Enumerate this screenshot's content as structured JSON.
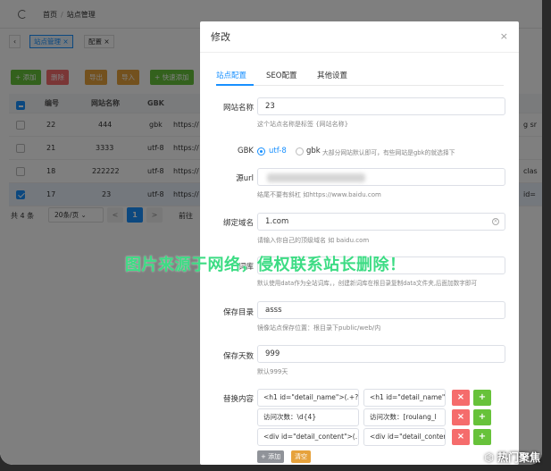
{
  "background": {
    "breadcrumb": [
      "首页",
      "站点管理"
    ],
    "tags": [
      {
        "label": "站点管理",
        "active": true
      },
      {
        "label": "配置",
        "active": false
      }
    ],
    "toolbar": [
      {
        "label": "+ 添加",
        "color": "#67c23a"
      },
      {
        "label": "删除",
        "color": "#f56c6c"
      },
      {
        "label": "导出",
        "color": "#e6a23c"
      },
      {
        "label": "导入",
        "color": "#e6a23c"
      },
      {
        "label": "+ 快速添加",
        "color": "#67c23a"
      }
    ],
    "table": {
      "headers": [
        "编号",
        "网站名称",
        "GBK",
        ""
      ],
      "rows": [
        {
          "id": "22",
          "name": "444",
          "gbk": "gbk",
          "url": "https://",
          "tail": "g sr",
          "checked": false
        },
        {
          "id": "21",
          "name": "3333",
          "gbk": "utf-8",
          "url": "https://",
          "tail": "",
          "checked": false
        },
        {
          "id": "18",
          "name": "222222",
          "gbk": "utf-8",
          "url": "https://",
          "tail": "clas",
          "checked": false
        },
        {
          "id": "17",
          "name": "23",
          "gbk": "utf-8",
          "url": "https://",
          "tail": "id=",
          "checked": true
        }
      ]
    },
    "pager": {
      "total": "共 4 条",
      "page_size": "20条/页",
      "prev": "<",
      "current": "1",
      "next": ">",
      "goto": "前往"
    }
  },
  "modal": {
    "title": "修改",
    "close": "×",
    "tabs": [
      {
        "label": "站点配置",
        "active": true
      },
      {
        "label": "SEO配置",
        "active": false
      },
      {
        "label": "其他设置",
        "active": false
      }
    ],
    "site_name": {
      "label": "网站名称",
      "value": "23",
      "hint": "这个站点名称是标签 {网站名称}"
    },
    "gbk": {
      "label": "GBK",
      "options": [
        "utf-8",
        "gbk"
      ],
      "selected": "utf-8",
      "hint": "大部分网站默认即可，有些网站是gbk的就选择下"
    },
    "source_url": {
      "label": "源url",
      "hint": "结尾不要有斜杠 如https://www.baidu.com"
    },
    "domain": {
      "label": "绑定域名",
      "value": "1.com",
      "hint": "请输入你自己的顶级域名 如 baidu.com"
    },
    "keywords": {
      "label": "词库",
      "hint": "默认使用data作为全站词库，，创建新词库在根目录复制data文件夹,后面加数字即可"
    },
    "save_dir": {
      "label": "保存目录",
      "value": "asss",
      "hint": "镜像站点保存位置：根目录下public/web/内"
    },
    "save_days": {
      "label": "保存天数",
      "value": "999",
      "hint": "默认999天"
    },
    "replace": {
      "label": "替换内容",
      "rows": [
        {
          "from": "<h1 id=\"detail_name\">(.+?)<",
          "to": "<h1 id=\"detail_name\">"
        },
        {
          "from": "访问次数：\\d{4}",
          "to": "访问次数：[roulang_l"
        },
        {
          "from": "<div id=\"detail_content\">(.+",
          "to": "<div id=\"detail_conter"
        }
      ],
      "bottom_buttons": [
        {
          "label": "+ 添加",
          "color": "#909399"
        },
        {
          "label": "清空",
          "color": "#e6a23c"
        }
      ]
    }
  },
  "watermark": "图片来源于网络，侵权联系站长删除！",
  "corner_label": "热门聚焦"
}
